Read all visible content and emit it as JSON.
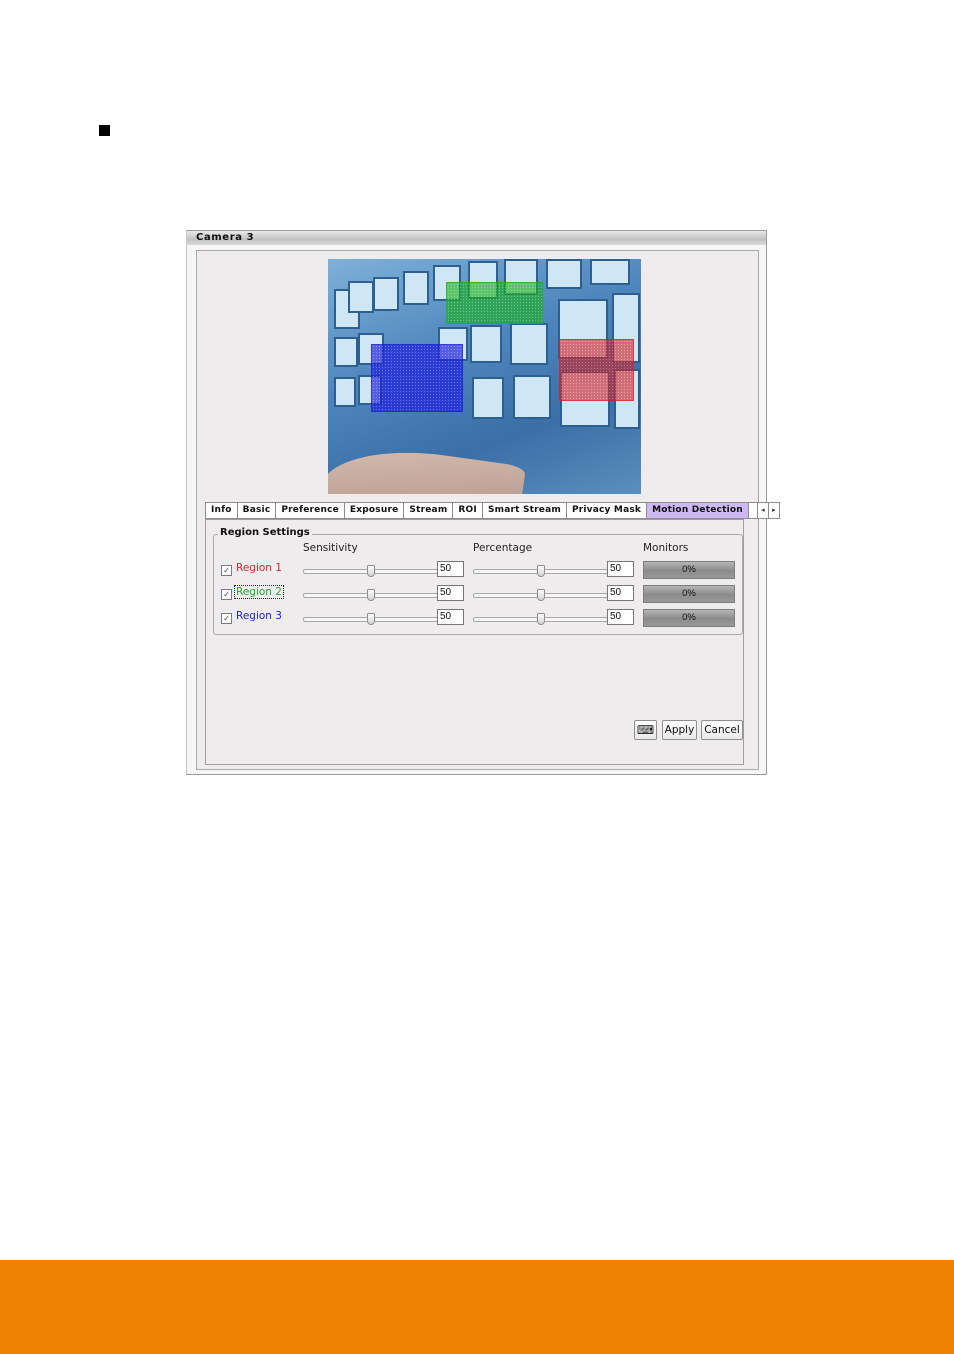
{
  "page": {
    "bullet_icon": "square-bullet",
    "footer_color": "#ef8200"
  },
  "window": {
    "title": "Camera 3"
  },
  "preview": {
    "regions": [
      {
        "name": "Region 1",
        "color": "#d1232b"
      },
      {
        "name": "Region 2",
        "color": "#1bb21b"
      },
      {
        "name": "Region 3",
        "color": "#1c1ce0"
      }
    ]
  },
  "tabs": {
    "items": [
      {
        "label": "Info"
      },
      {
        "label": "Basic"
      },
      {
        "label": "Preference"
      },
      {
        "label": "Exposure"
      },
      {
        "label": "Stream"
      },
      {
        "label": "ROI"
      },
      {
        "label": "Smart Stream"
      },
      {
        "label": "Privacy Mask"
      },
      {
        "label": "Motion Detection",
        "active": true
      }
    ],
    "prev_icon": "◂",
    "next_icon": "▸"
  },
  "region_settings": {
    "title": "Region Settings",
    "headers": {
      "sensitivity": "Sensitivity",
      "percentage": "Percentage",
      "monitors": "Monitors"
    },
    "rows": [
      {
        "label": "Region 1",
        "checked": true,
        "color": "#e0232a",
        "sensitivity": "50",
        "percentage": "50",
        "monitor": "0%"
      },
      {
        "label": "Region 2",
        "checked": true,
        "color": "#1fae2a",
        "sensitivity": "50",
        "percentage": "50",
        "monitor": "0%"
      },
      {
        "label": "Region 3",
        "checked": true,
        "color": "#2222d0",
        "sensitivity": "50",
        "percentage": "50",
        "monitor": "0%"
      }
    ],
    "slider_max": 100,
    "check_mark": "✓"
  },
  "buttons": {
    "keyboard_icon": "⌨",
    "apply": "Apply",
    "cancel": "Cancel"
  }
}
